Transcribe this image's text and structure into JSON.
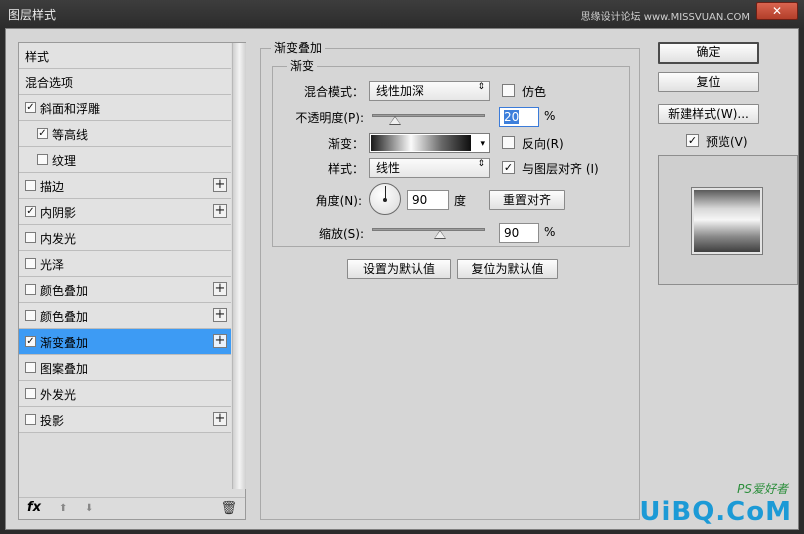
{
  "window": {
    "title": "图层样式",
    "watermark_top": "思缘设计论坛 www.MISSVUAN.COM",
    "close_label": "✕"
  },
  "left_panel": {
    "items": [
      {
        "label": "样式",
        "checkbox": false,
        "checked": false,
        "plus": false,
        "indent": 0,
        "selected": false
      },
      {
        "label": "混合选项",
        "checkbox": false,
        "checked": false,
        "plus": false,
        "indent": 0,
        "selected": false
      },
      {
        "label": "斜面和浮雕",
        "checkbox": true,
        "checked": true,
        "plus": false,
        "indent": 0,
        "selected": false
      },
      {
        "label": "等高线",
        "checkbox": true,
        "checked": true,
        "plus": false,
        "indent": 1,
        "selected": false
      },
      {
        "label": "纹理",
        "checkbox": true,
        "checked": false,
        "plus": false,
        "indent": 1,
        "selected": false
      },
      {
        "label": "描边",
        "checkbox": true,
        "checked": false,
        "plus": true,
        "indent": 0,
        "selected": false
      },
      {
        "label": "内阴影",
        "checkbox": true,
        "checked": true,
        "plus": true,
        "indent": 0,
        "selected": false
      },
      {
        "label": "内发光",
        "checkbox": true,
        "checked": false,
        "plus": false,
        "indent": 0,
        "selected": false
      },
      {
        "label": "光泽",
        "checkbox": true,
        "checked": false,
        "plus": false,
        "indent": 0,
        "selected": false
      },
      {
        "label": "颜色叠加",
        "checkbox": true,
        "checked": false,
        "plus": true,
        "indent": 0,
        "selected": false
      },
      {
        "label": "颜色叠加",
        "checkbox": true,
        "checked": false,
        "plus": true,
        "indent": 0,
        "selected": false
      },
      {
        "label": "渐变叠加",
        "checkbox": true,
        "checked": true,
        "plus": true,
        "indent": 0,
        "selected": true
      },
      {
        "label": "图案叠加",
        "checkbox": true,
        "checked": false,
        "plus": false,
        "indent": 0,
        "selected": false
      },
      {
        "label": "外发光",
        "checkbox": true,
        "checked": false,
        "plus": false,
        "indent": 0,
        "selected": false
      },
      {
        "label": "投影",
        "checkbox": true,
        "checked": false,
        "plus": true,
        "indent": 0,
        "selected": false
      }
    ],
    "footer": {
      "fx": "fx",
      "up": "⬆",
      "down": "⬇",
      "trash": "🗑"
    }
  },
  "gradient_overlay": {
    "section_title": "渐变叠加",
    "group_title": "渐变",
    "blend_mode": {
      "label": "混合模式：",
      "value": "线性加深"
    },
    "dither": {
      "label": "仿色",
      "checked": false
    },
    "opacity": {
      "label": "不透明度(P):",
      "value": "20",
      "unit": "%",
      "fraction": 0.2
    },
    "gradient": {
      "label": "渐变："
    },
    "reverse": {
      "label": "反向(R)",
      "checked": false
    },
    "style": {
      "label": "样式：",
      "value": "线性"
    },
    "align": {
      "label": "与图层对齐 (I)",
      "checked": true
    },
    "angle": {
      "label": "角度(N):",
      "value": "90",
      "unit": "度"
    },
    "reset_align_label": "重置对齐",
    "scale": {
      "label": "缩放(S):",
      "value": "90",
      "unit": "%",
      "fraction": 0.6
    },
    "set_default_label": "设置为默认值",
    "reset_default_label": "复位为默认值"
  },
  "right_panel": {
    "ok_label": "确定",
    "reset_label": "复位",
    "new_style_label": "新建样式(W)...",
    "preview": {
      "label": "预览(V)",
      "checked": true
    }
  },
  "watermark": {
    "main": "UiBQ.CoM",
    "sub": "PS爱好者"
  },
  "symbols": {
    "check": "✓",
    "plus": "+",
    "updown": "⇕",
    "down": "▾"
  }
}
